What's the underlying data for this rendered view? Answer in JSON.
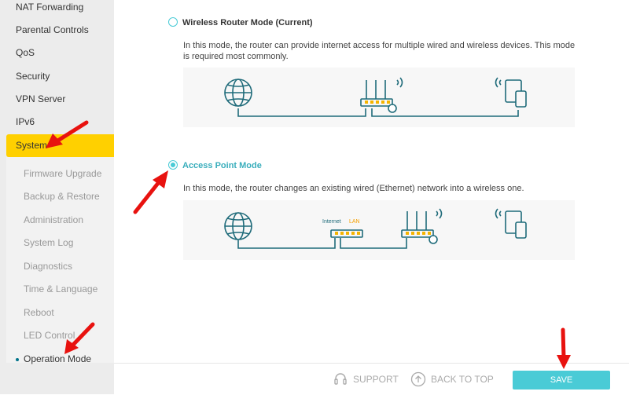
{
  "sidebar": {
    "items": [
      {
        "label": "NAT Forwarding"
      },
      {
        "label": "Parental Controls"
      },
      {
        "label": "QoS"
      },
      {
        "label": "Security"
      },
      {
        "label": "VPN Server"
      },
      {
        "label": "IPv6"
      },
      {
        "label": "System"
      }
    ],
    "sub_items": [
      {
        "label": "Firmware Upgrade"
      },
      {
        "label": "Backup & Restore"
      },
      {
        "label": "Administration"
      },
      {
        "label": "System Log"
      },
      {
        "label": "Diagnostics"
      },
      {
        "label": "Time & Language"
      },
      {
        "label": "Reboot"
      },
      {
        "label": "LED Control"
      },
      {
        "label": "Operation Mode"
      }
    ]
  },
  "modes": {
    "router": {
      "title": "Wireless Router Mode (Current)",
      "description": "In this mode, the router can provide internet access for multiple wired and wireless devices. This mode is required most commonly.",
      "selected": false
    },
    "ap": {
      "title": "Access Point Mode",
      "description": "In this mode, the router changes an existing wired (Ethernet) network into a wireless one.",
      "selected": true,
      "internet_label": "Internet",
      "lan_label": "LAN"
    }
  },
  "footer": {
    "support": "SUPPORT",
    "back_to_top": "BACK TO TOP",
    "save": "SAVE"
  },
  "colors": {
    "accent": "#4acbd6",
    "active_nav": "#ffd000",
    "diagram_stroke": "#1f6b7a",
    "port_yellow": "#f5b400",
    "annotation_arrow": "#e8120f"
  }
}
